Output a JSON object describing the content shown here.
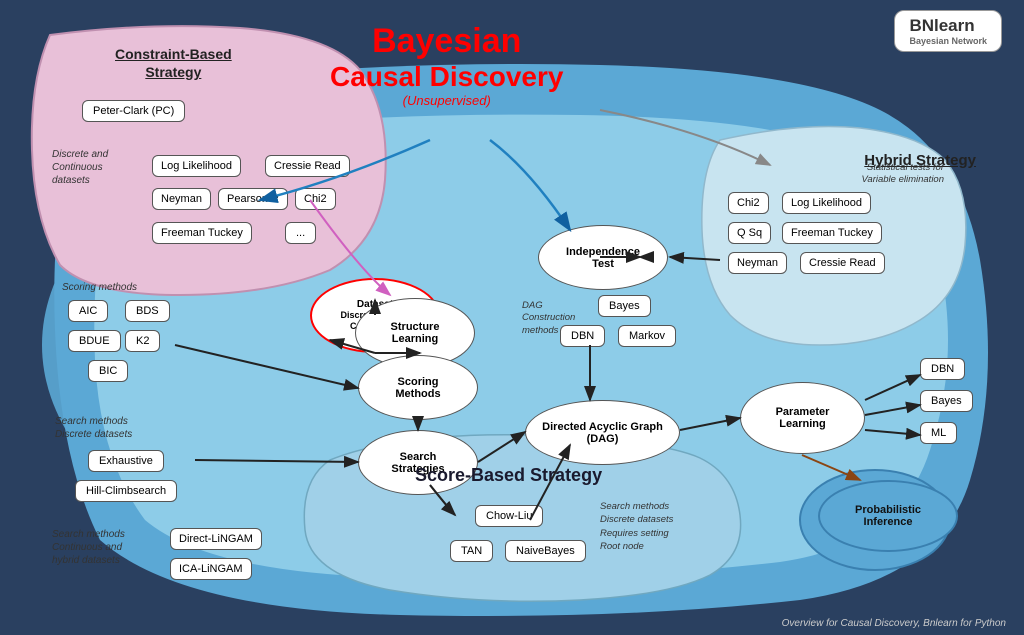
{
  "title": {
    "main_line1": "Bayesian",
    "main_line2": "Causal Discovery",
    "unsupervised": "(Unsupervised)"
  },
  "strategies": {
    "constraint": "Constraint-Based\nStrategy",
    "hybrid": "Hybrid Strategy",
    "score_based": "Score-Based Strategy"
  },
  "constraint_boxes": [
    "Peter-Clark (PC)",
    "Log Likelihood",
    "Cressie Read",
    "Neyman",
    "Pearson R",
    "Chi2",
    "Freeman Tuckey",
    "..."
  ],
  "constraint_label": "Discrete and\nContinuous\ndatasets",
  "hybrid_boxes": [
    "Chi2",
    "Log Likelihood",
    "Q Sq",
    "Freeman Tuckey",
    "Neyman",
    "Cressie Read"
  ],
  "hybrid_label": "Statistical tests for\nVariable elimination",
  "scoring_methods_boxes": [
    "AIC",
    "BDS",
    "BDUE",
    "K2",
    "BIC"
  ],
  "scoring_methods_label": "Scoring methods",
  "search_methods_label": "Search methods\nDiscrete datasets",
  "search_boxes": [
    "Exhaustive",
    "Hill-Climbsearch"
  ],
  "search_methods_label2": "Search methods\nContinuous and\nhybrid datasets",
  "search_boxes2": [
    "Direct-LiNGAM",
    "ICA-LiNGAM"
  ],
  "structure_learning_oval": "Structure\nLearning",
  "scoring_methods_oval": "Scoring\nMethods",
  "search_strategies_oval": "Search\nStrategies",
  "dataset_oval": "Dataset\nDiscrete   Hybrid\nContinuous",
  "independence_test_oval": "Independence\nTest",
  "dag_construction_label": "DAG\nConstruction\nmethods",
  "dag_boxes": [
    "Bayes",
    "DBN",
    "Markov"
  ],
  "dag_oval": "Directed Acyclic Graph\n(DAG)",
  "parameter_learning_oval": "Parameter\nLearning",
  "prob_inference_oval": "Probabilistic\nInference",
  "parameter_boxes": [
    "DBN",
    "Bayes",
    "ML"
  ],
  "score_based_boxes": [
    {
      "label": "Chow-Liu",
      "note": ""
    },
    {
      "label": "TAN",
      "note": ""
    },
    {
      "label": "NaiveBayes",
      "note": ""
    }
  ],
  "score_search_label": "Search methods\nDiscrete datasets\nRequires setting\nRoot node",
  "bnlearn_logo": "BNlearn",
  "footer": "Overview for Causal Discovery, Bnlearn for Python"
}
